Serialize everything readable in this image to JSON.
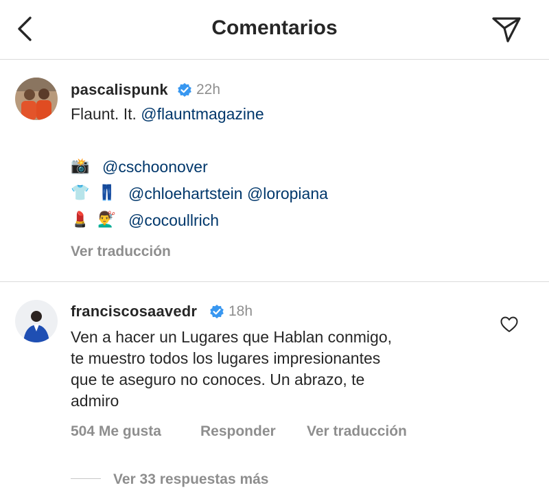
{
  "header": {
    "title": "Comentarios"
  },
  "caption": {
    "username": "pascalispunk",
    "time": "22h",
    "line1_text": "Flaunt. It.",
    "line1_mention": "@flauntmagazine",
    "credits": [
      {
        "emojis": [
          "📸"
        ],
        "mentions": "@cschoonover"
      },
      {
        "emojis": [
          "👕",
          "👖"
        ],
        "mentions": "@chloehartstein @loropiana"
      },
      {
        "emojis": [
          "💄",
          "💇‍♂️"
        ],
        "mentions": "@cocoullrich"
      }
    ],
    "translate": "Ver traducción"
  },
  "comment": {
    "username": "franciscosaavedr",
    "time": "18h",
    "lines": [
      "Ven a hacer un Lugares que Hablan conmigo,",
      "te muestro todos los lugares impresionantes",
      "que te aseguro no conoces. Un abrazo, te",
      "admiro"
    ],
    "likes": "504 Me gusta",
    "reply": "Responder",
    "translate": "Ver traducción",
    "view_replies": "Ver 33 respuestas más"
  },
  "icons": {
    "back": "chevron-left-icon",
    "share": "paper-plane-icon",
    "verified": "verified-badge-icon",
    "heart": "heart-outline-icon"
  },
  "colors": {
    "mention": "#00376b",
    "verified": "#3897f0",
    "muted": "#8e8e8e"
  }
}
